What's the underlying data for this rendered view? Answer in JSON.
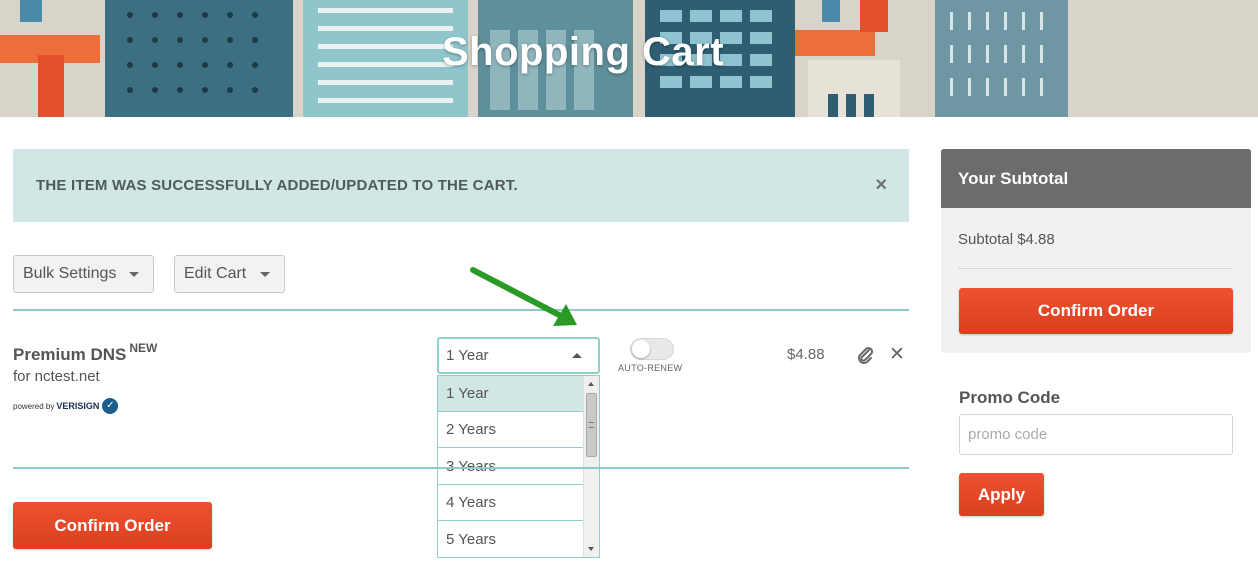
{
  "banner": {
    "title": "Shopping Cart"
  },
  "alert": {
    "message": "THE ITEM WAS SUCCESSFULLY ADDED/UPDATED TO THE CART.",
    "close_icon": "×"
  },
  "toolbar": {
    "bulk_settings": "Bulk Settings",
    "edit_cart": "Edit Cart"
  },
  "item": {
    "name": "Premium DNS",
    "badge": "NEW",
    "domain": "for nctest.net",
    "powered_by": "powered by",
    "provider": "VERISIGN",
    "term": {
      "selected": "1 Year",
      "options": [
        "1 Year",
        "2 Years",
        "3 Years",
        "4 Years",
        "5 Years"
      ],
      "highlighted_index": 0
    },
    "auto_renew": {
      "label": "AUTO-RENEW",
      "enabled": false
    },
    "price": "$4.88"
  },
  "actions": {
    "confirm_order": "Confirm Order"
  },
  "sidebar": {
    "title": "Your Subtotal",
    "subtotal": "Subtotal $4.88",
    "confirm_order": "Confirm Order",
    "promo": {
      "label": "Promo Code",
      "placeholder": "promo code",
      "apply": "Apply"
    }
  },
  "colors": {
    "accent_red": "#e84a2a",
    "teal": "#8fcbc6",
    "alert_bg": "#d0e7e6",
    "panel_header": "#6c6c6c"
  }
}
